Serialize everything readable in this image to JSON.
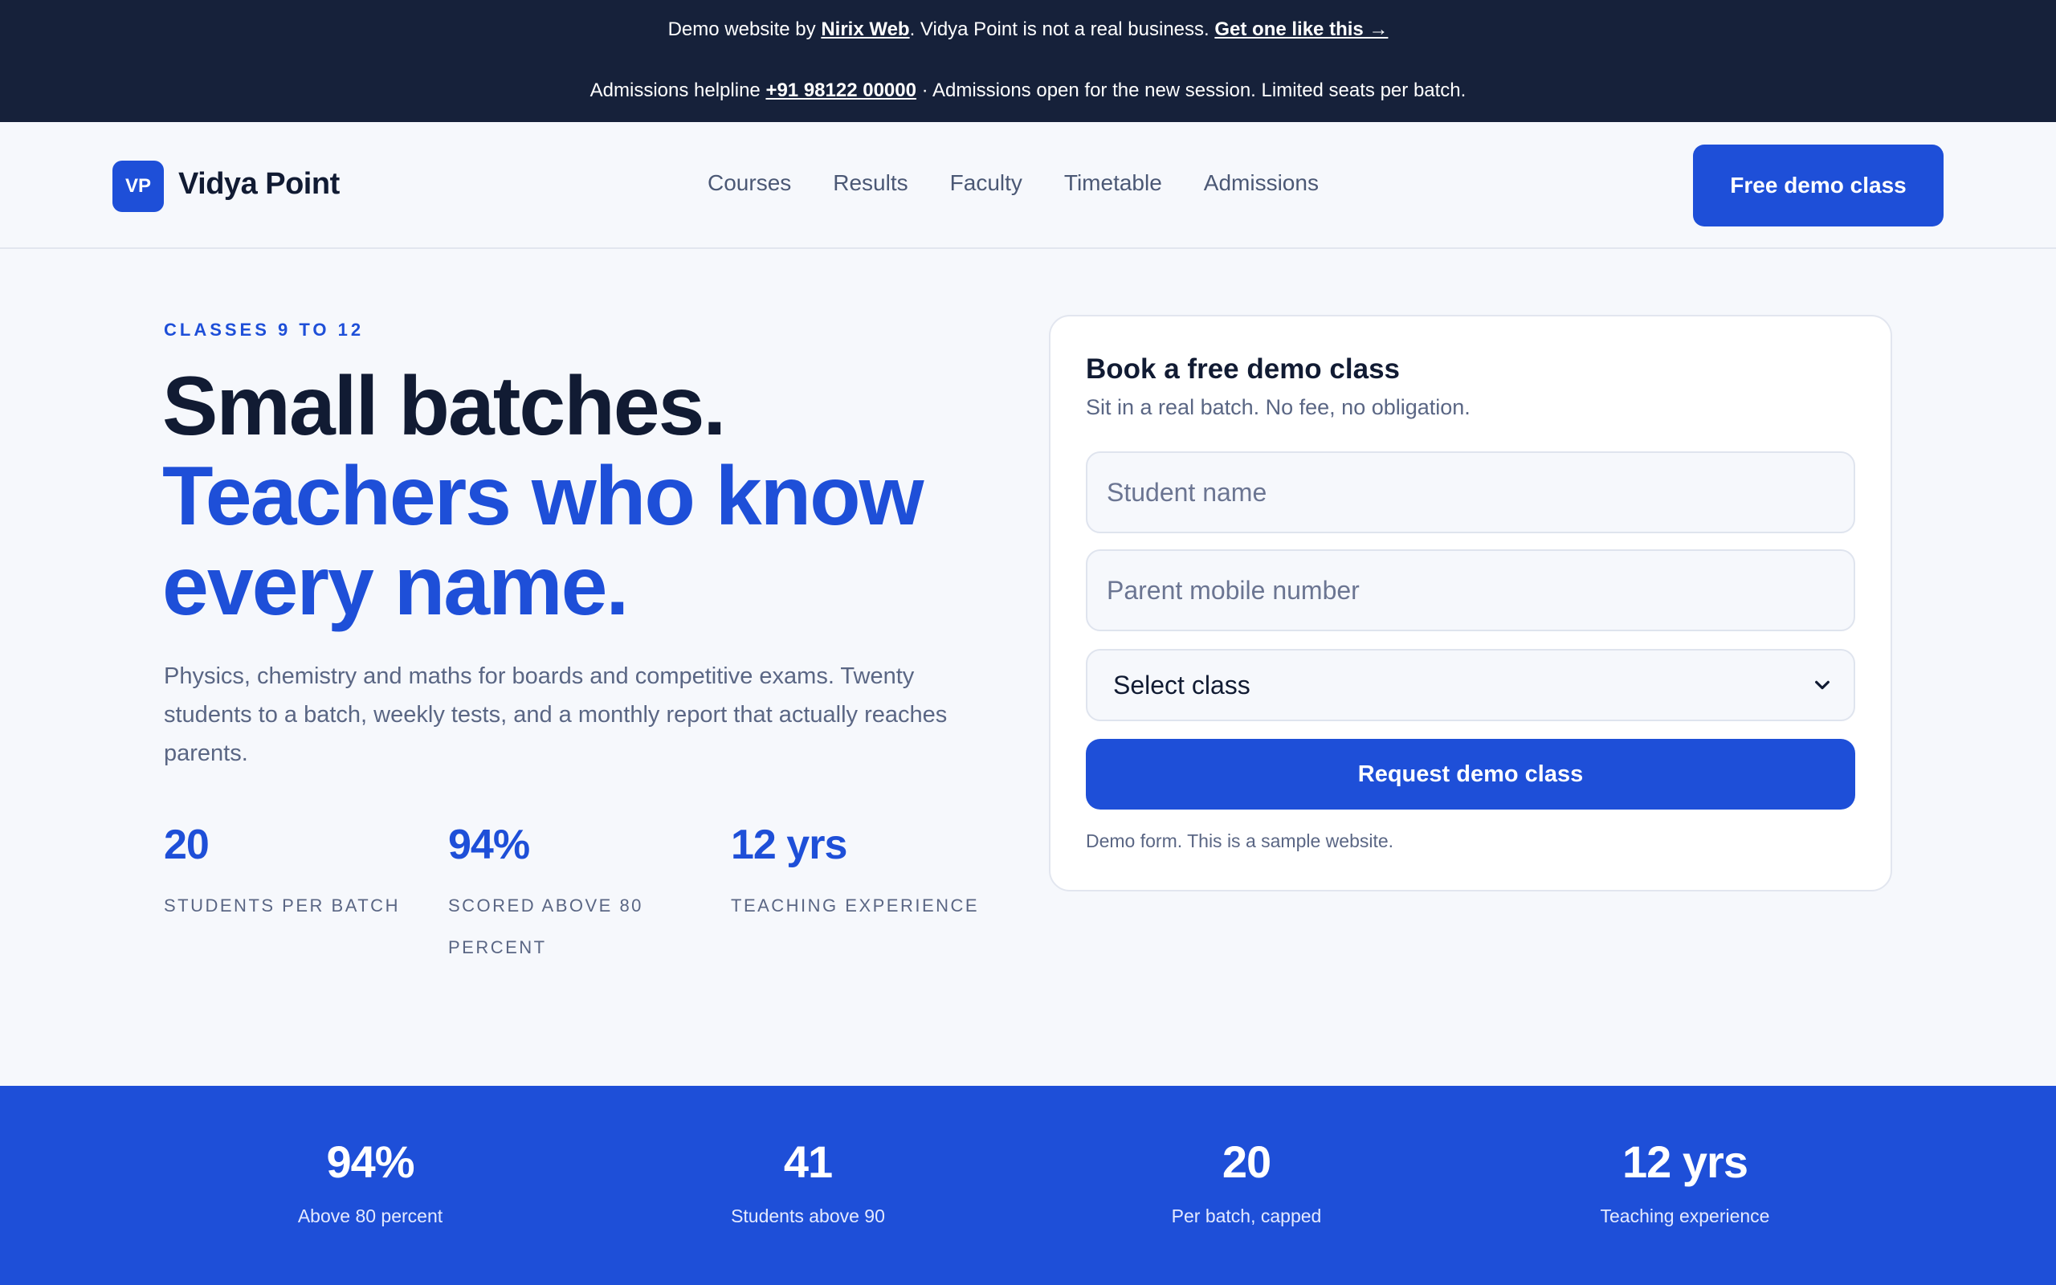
{
  "announcement": {
    "line1_prefix": "Demo website by ",
    "line1_link": "Nirix Web",
    "line1_middle": ". Vidya Point is not a real business. ",
    "line1_cta": "Get one like this →",
    "line2_prefix": "Admissions helpline ",
    "line2_phone": "+91 98122 00000",
    "line2_suffix": " · Admissions open for the new session. Limited seats per batch."
  },
  "header": {
    "logo_initials": "VP",
    "brand_name": "Vidya Point",
    "nav": [
      "Courses",
      "Results",
      "Faculty",
      "Timetable",
      "Admissions"
    ],
    "cta_label": "Free demo class"
  },
  "hero": {
    "eyebrow": "CLASSES 9 TO 12",
    "headline_line1": "Small batches.",
    "headline_line2": "Teachers who know",
    "headline_line3": "every name.",
    "subcopy": "Physics, chemistry and maths for boards and competitive exams. Twenty students to a batch, weekly tests, and a monthly report that actually reaches parents.",
    "stats": [
      {
        "value": "20",
        "label": "Students per batch"
      },
      {
        "value": "94%",
        "label": "Scored above 80 percent"
      },
      {
        "value": "12 yrs",
        "label": "Teaching experience"
      }
    ]
  },
  "form": {
    "title": "Book a free demo class",
    "subtitle": "Sit in a real batch. No fee, no obligation.",
    "name_placeholder": "Student name",
    "phone_placeholder": "Parent mobile number",
    "class_select_value": "Select class",
    "submit_label": "Request demo class",
    "note": "Demo form. This is a sample website."
  },
  "band": {
    "stats": [
      {
        "value": "94%",
        "label": "Above 80 percent"
      },
      {
        "value": "41",
        "label": "Students above 90"
      },
      {
        "value": "20",
        "label": "Per batch, capped"
      },
      {
        "value": "12 yrs",
        "label": "Teaching experience"
      }
    ]
  },
  "colors": {
    "accent": "#1e4fd8",
    "topbar": "#16213a",
    "text_dark": "#111b33",
    "text_muted": "#5a6684",
    "page_bg": "#f6f8fc"
  }
}
